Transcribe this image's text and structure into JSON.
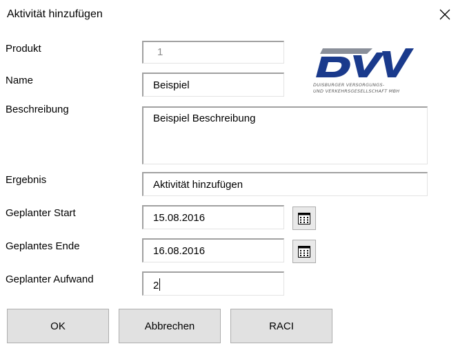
{
  "dialog": {
    "title": "Aktivität hinzufügen"
  },
  "icons": {
    "close": "close-icon",
    "calendar": "calendar-icon"
  },
  "logo": {
    "text": "DVV",
    "subtitle_line1": "DUISBURGER VERSORGUNGS-",
    "subtitle_line2": "UND VERKEHRSGESELLSCHAFT MBH",
    "colors": {
      "navy": "#1a3a8c",
      "gray": "#8a8f99"
    }
  },
  "form": {
    "produkt": {
      "label": "Produkt",
      "value": "1"
    },
    "name": {
      "label": "Name",
      "value": "Beispiel"
    },
    "beschreibung": {
      "label": "Beschreibung",
      "value": "Beispiel Beschreibung"
    },
    "ergebnis": {
      "label": "Ergebnis",
      "value": "Aktivität hinzufügen"
    },
    "start": {
      "label": "Geplanter Start",
      "value": "15.08.2016"
    },
    "ende": {
      "label": "Geplantes Ende",
      "value": "16.08.2016"
    },
    "aufwand": {
      "label": "Geplanter Aufwand",
      "value": "2"
    }
  },
  "buttons": {
    "ok": "OK",
    "cancel": "Abbrechen",
    "raci": "RACI"
  }
}
